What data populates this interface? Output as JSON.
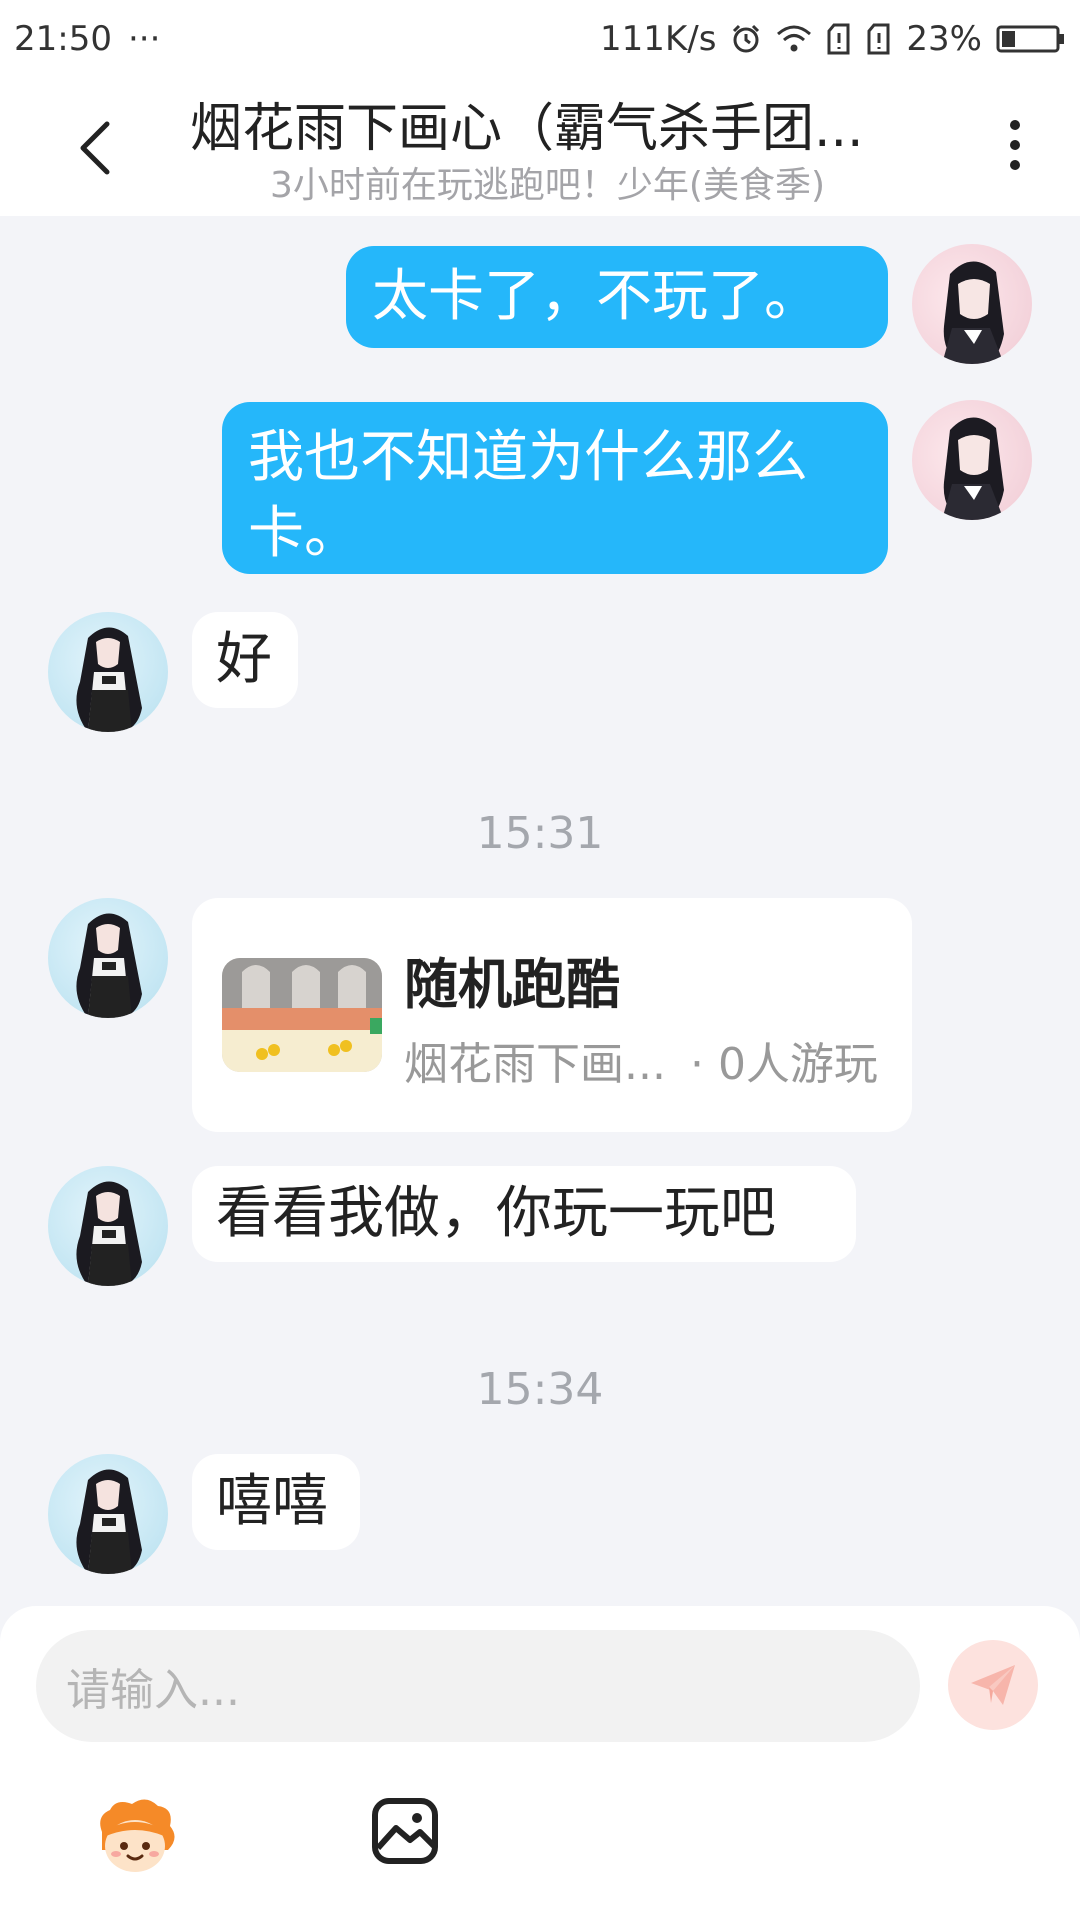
{
  "status_bar": {
    "time": "21:50",
    "more": "···",
    "network_speed": "111K/s",
    "battery": "23%"
  },
  "header": {
    "title": "烟花雨下画心（霸气杀手团...",
    "subtitle": "3小时前在玩逃跑吧！少年(美食季)"
  },
  "messages": [
    {
      "sender": "me",
      "text": "太卡了，不玩了。"
    },
    {
      "sender": "me",
      "text": "我也不知道为什么那么卡。"
    },
    {
      "sender": "other",
      "text": "好"
    },
    {
      "type": "timestamp",
      "text": "15:31"
    },
    {
      "sender": "other",
      "type": "game_card",
      "title": "随机跑酷",
      "author": "烟花雨下画...",
      "players": "· 0人游玩"
    },
    {
      "sender": "other",
      "text": "看看我做，你玩一玩吧"
    },
    {
      "type": "timestamp",
      "text": "15:34"
    },
    {
      "sender": "other",
      "text": "嘻嘻"
    }
  ],
  "input": {
    "placeholder": "请输入..."
  },
  "icons": {
    "back": "chevron-left-icon",
    "more": "more-vertical-icon",
    "send": "send-icon",
    "emoji": "emoji-mascot-icon",
    "image": "image-icon"
  },
  "colors": {
    "my_bubble": "#25b7fa",
    "other_bubble": "#ffffff",
    "chat_background": "#f3f4f8",
    "send_button": "#fde2de"
  }
}
